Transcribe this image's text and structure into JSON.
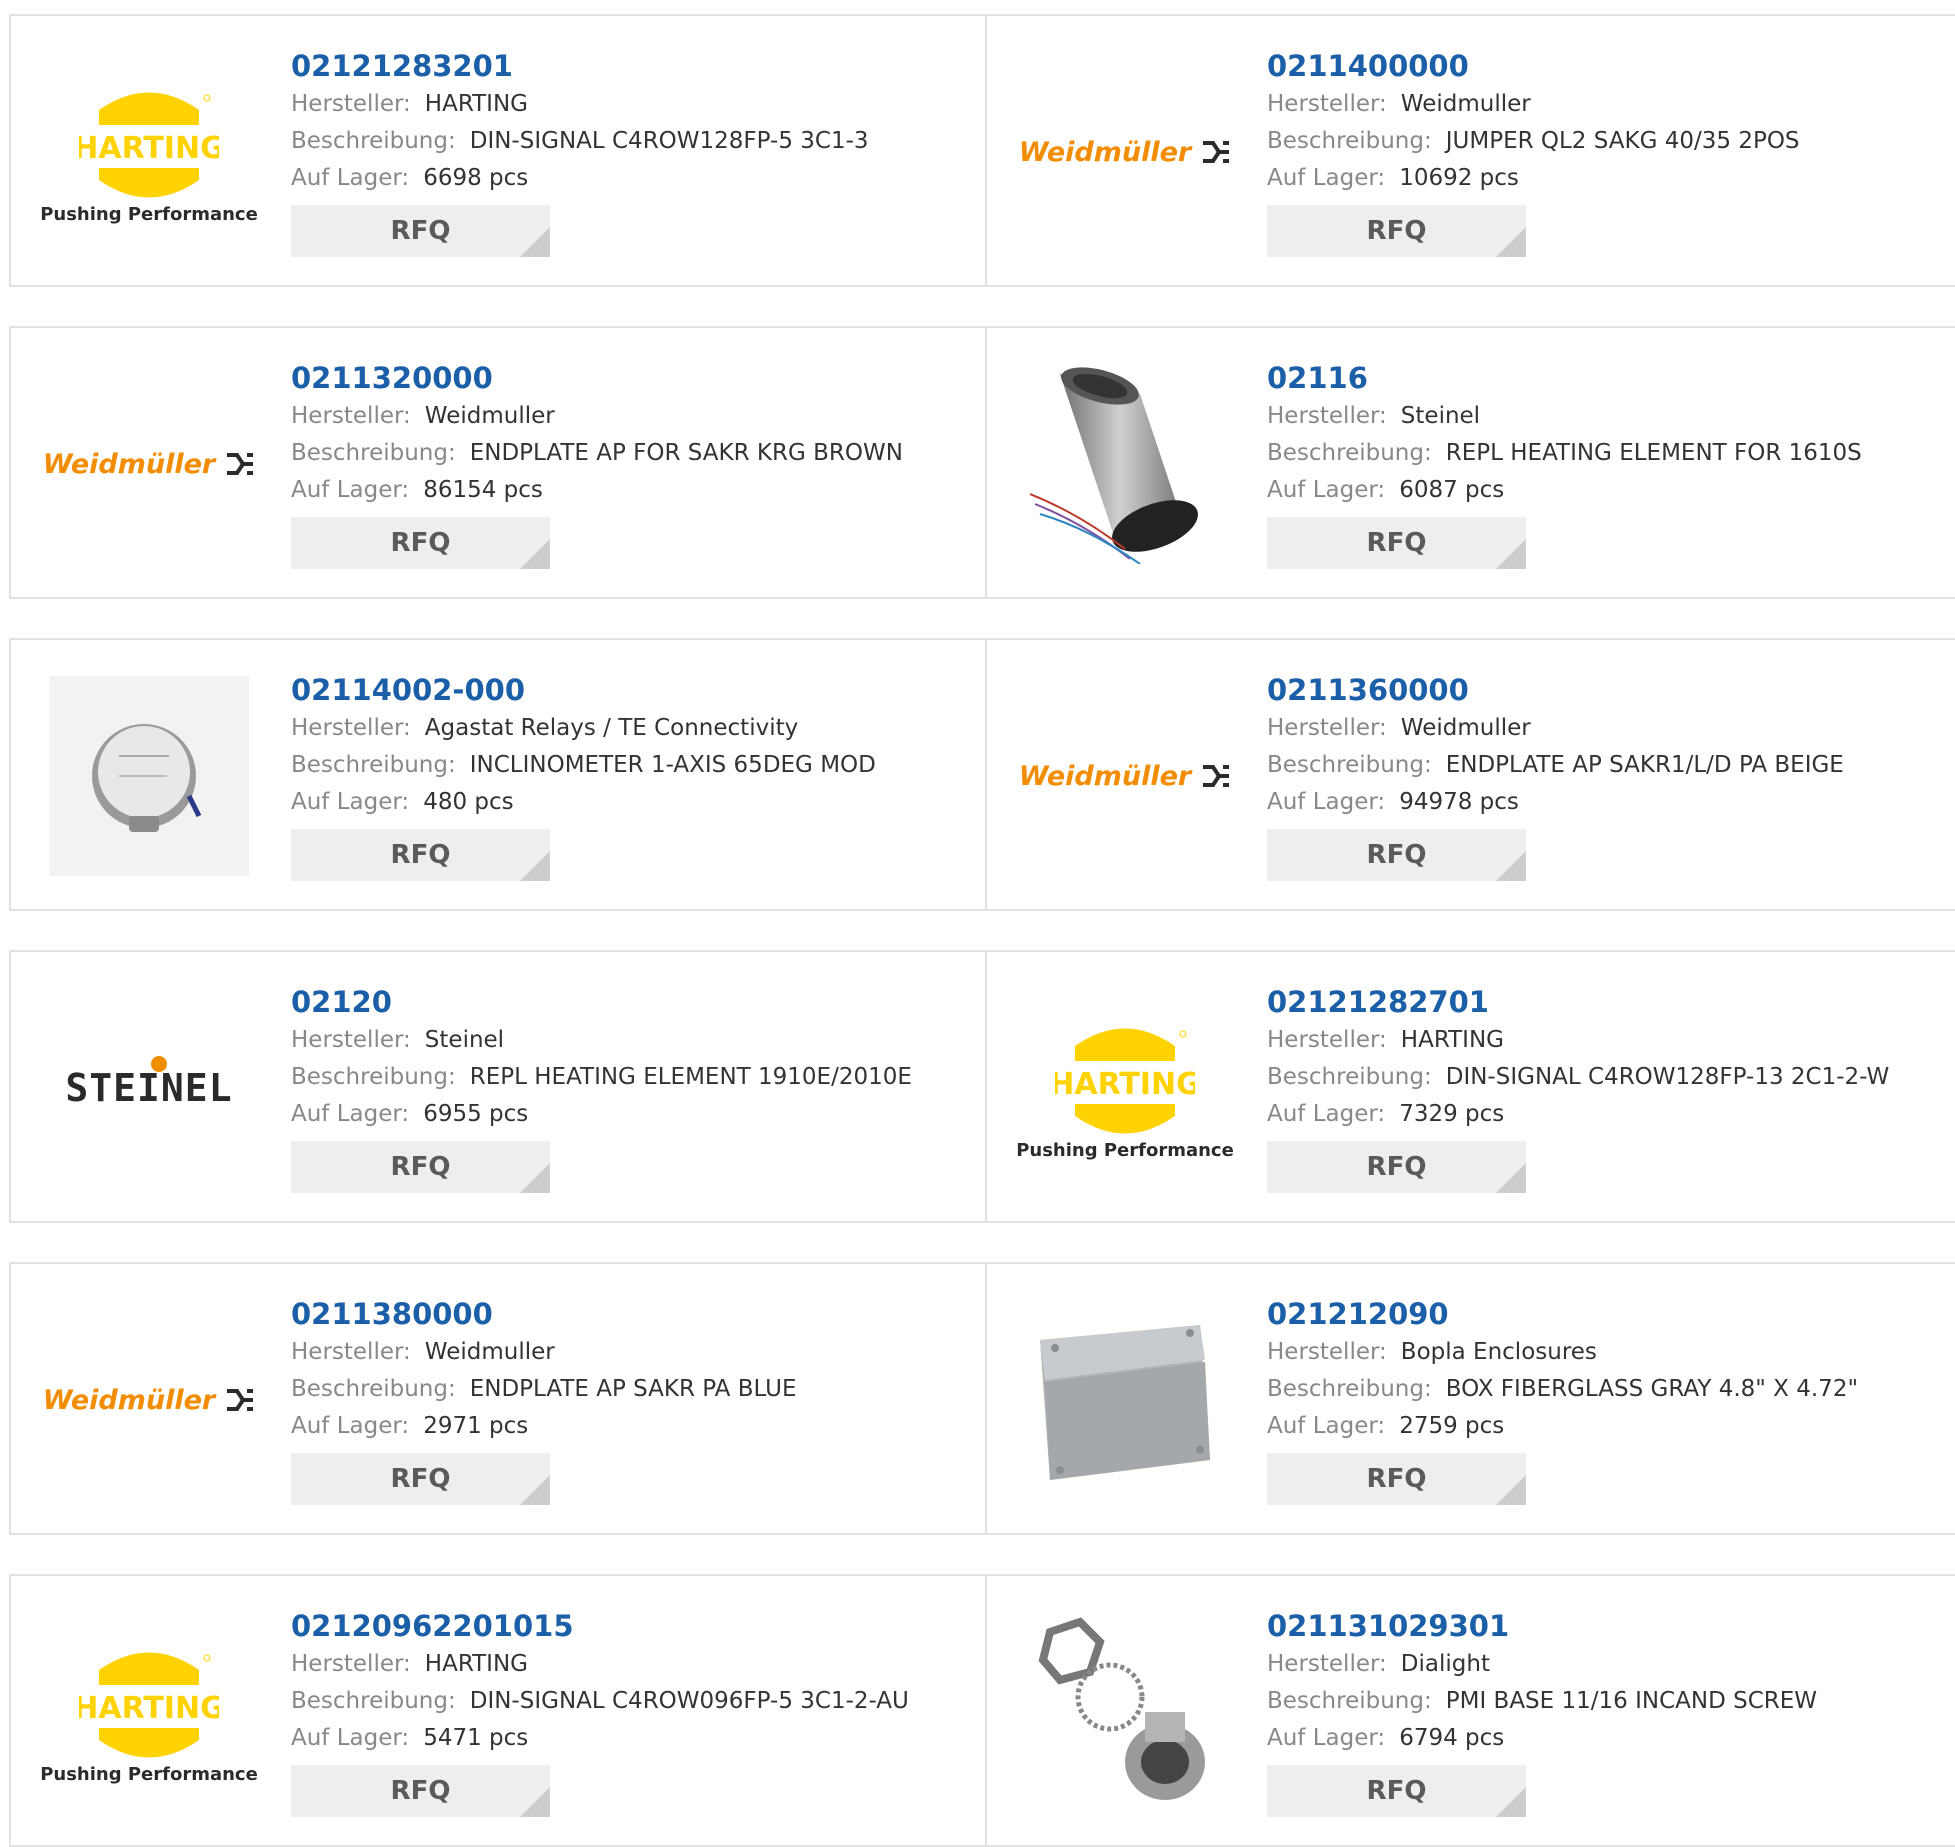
{
  "labels": {
    "manufacturer": "Hersteller:",
    "description": "Beschreibung:",
    "stock": "Auf Lager:",
    "rfq": "RFQ"
  },
  "logos": {
    "harting_word": "HARTING",
    "harting_tagline": "Pushing Performance",
    "weidmuller": "Weidmüller",
    "steinel": "STEINEL"
  },
  "products": [
    {
      "part": "02121283201",
      "manufacturer": "HARTING",
      "description": "DIN-SIGNAL C4ROW128FP-5 3C1-3",
      "stock": "6698 pcs",
      "image": "harting-logo"
    },
    {
      "part": "0211400000",
      "manufacturer": "Weidmuller",
      "description": "JUMPER QL2 SAKG 40/35 2POS",
      "stock": "10692 pcs",
      "image": "weidmuller-logo"
    },
    {
      "part": "0211320000",
      "manufacturer": "Weidmuller",
      "description": "ENDPLATE AP FOR SAKR KRG BROWN",
      "stock": "86154 pcs",
      "image": "weidmuller-logo"
    },
    {
      "part": "02116",
      "manufacturer": "Steinel",
      "description": "REPL HEATING ELEMENT FOR 1610S",
      "stock": "6087 pcs",
      "image": "heating-element-photo"
    },
    {
      "part": "02114002-000",
      "manufacturer": "Agastat Relays / TE Connectivity",
      "description": "INCLINOMETER 1-AXIS 65DEG MOD",
      "stock": "480 pcs",
      "image": "inclinometer-photo"
    },
    {
      "part": "0211360000",
      "manufacturer": "Weidmuller",
      "description": "ENDPLATE AP SAKR1/L/D PA BEIGE",
      "stock": "94978 pcs",
      "image": "weidmuller-logo"
    },
    {
      "part": "02120",
      "manufacturer": "Steinel",
      "description": "REPL HEATING ELEMENT 1910E/2010E",
      "stock": "6955 pcs",
      "image": "steinel-logo"
    },
    {
      "part": "02121282701",
      "manufacturer": "HARTING",
      "description": "DIN-SIGNAL C4ROW128FP-13 2C1-2-W",
      "stock": "7329 pcs",
      "image": "harting-logo"
    },
    {
      "part": "0211380000",
      "manufacturer": "Weidmuller",
      "description": "ENDPLATE AP SAKR PA BLUE",
      "stock": "2971 pcs",
      "image": "weidmuller-logo"
    },
    {
      "part": "021212090",
      "manufacturer": "Bopla Enclosures",
      "description": "BOX FIBERGLASS GRAY 4.8\" X 4.72\"",
      "stock": "2759 pcs",
      "image": "enclosure-box-photo"
    },
    {
      "part": "02120962201015",
      "manufacturer": "HARTING",
      "description": "DIN-SIGNAL C4ROW096FP-5 3C1-2-AU",
      "stock": "5471 pcs",
      "image": "harting-logo"
    },
    {
      "part": "021131029301",
      "manufacturer": "Dialight",
      "description": "PMI BASE 11/16 INCAND SCREW",
      "stock": "6794 pcs",
      "image": "lamp-base-photo"
    }
  ],
  "colors": {
    "link": "#1a5fa8",
    "label": "#888888",
    "value": "#333333",
    "border": "#e2e2e2",
    "button_bg": "#eeeeee",
    "harting_yellow": "#ffd200",
    "weidmuller_orange": "#f28c00"
  }
}
